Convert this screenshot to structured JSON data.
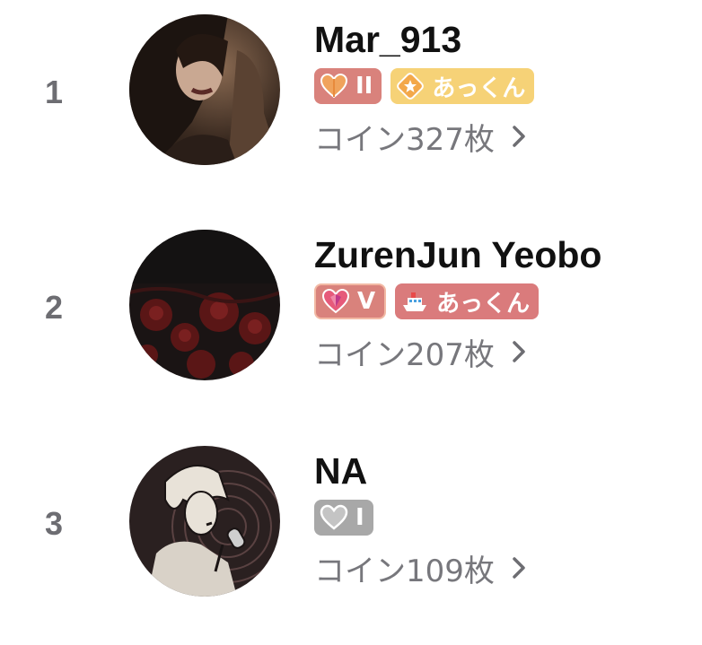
{
  "entries": [
    {
      "rank": "1",
      "name": "Mar_913",
      "level_badge": {
        "label": "II",
        "icon": "heart-orange-icon",
        "color": "#d9827c"
      },
      "fan_badge": {
        "label": "あっくん",
        "icon": "star-badge-icon",
        "color": "#f6d277"
      },
      "coins_text": "コイン327枚"
    },
    {
      "rank": "2",
      "name": "ZurenJun Yeobo",
      "level_badge": {
        "label": "V",
        "icon": "heart-gem-icon",
        "color": "#d9827c"
      },
      "fan_badge": {
        "label": "あっくん",
        "icon": "ship-icon",
        "color": "#da7b7c"
      },
      "coins_text": "コイン207枚"
    },
    {
      "rank": "3",
      "name": "NA",
      "level_badge": {
        "label": "I",
        "icon": "heart-outline-icon",
        "color": "#a8a8a8"
      },
      "coins_text": "コイン109枚"
    }
  ]
}
